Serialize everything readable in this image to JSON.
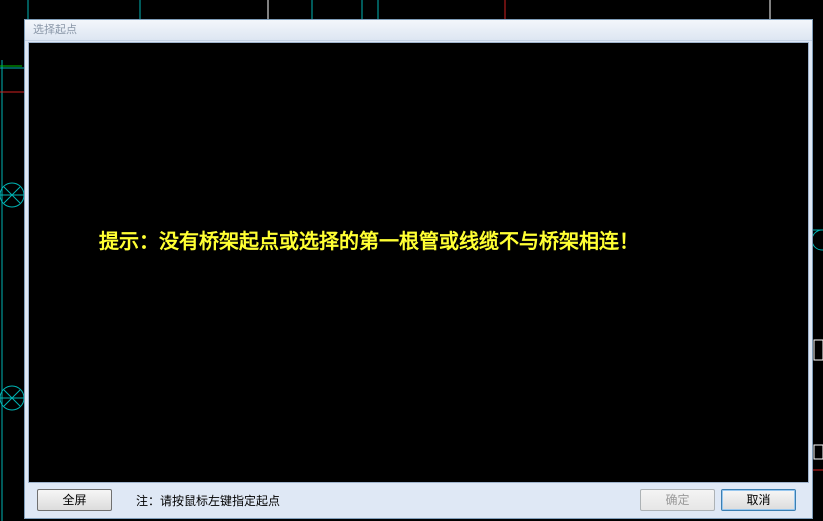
{
  "window": {
    "title": "选择起点"
  },
  "canvas": {
    "hint": "提示：没有桥架起点或选择的第一根管或线缆不与桥架相连！",
    "hint_color": "#ffff33",
    "background": "#000000"
  },
  "footer": {
    "fullscreen_label": "全屏",
    "note": "注：请按鼠标左键指定起点",
    "ok_label": "确定",
    "cancel_label": "取消"
  }
}
